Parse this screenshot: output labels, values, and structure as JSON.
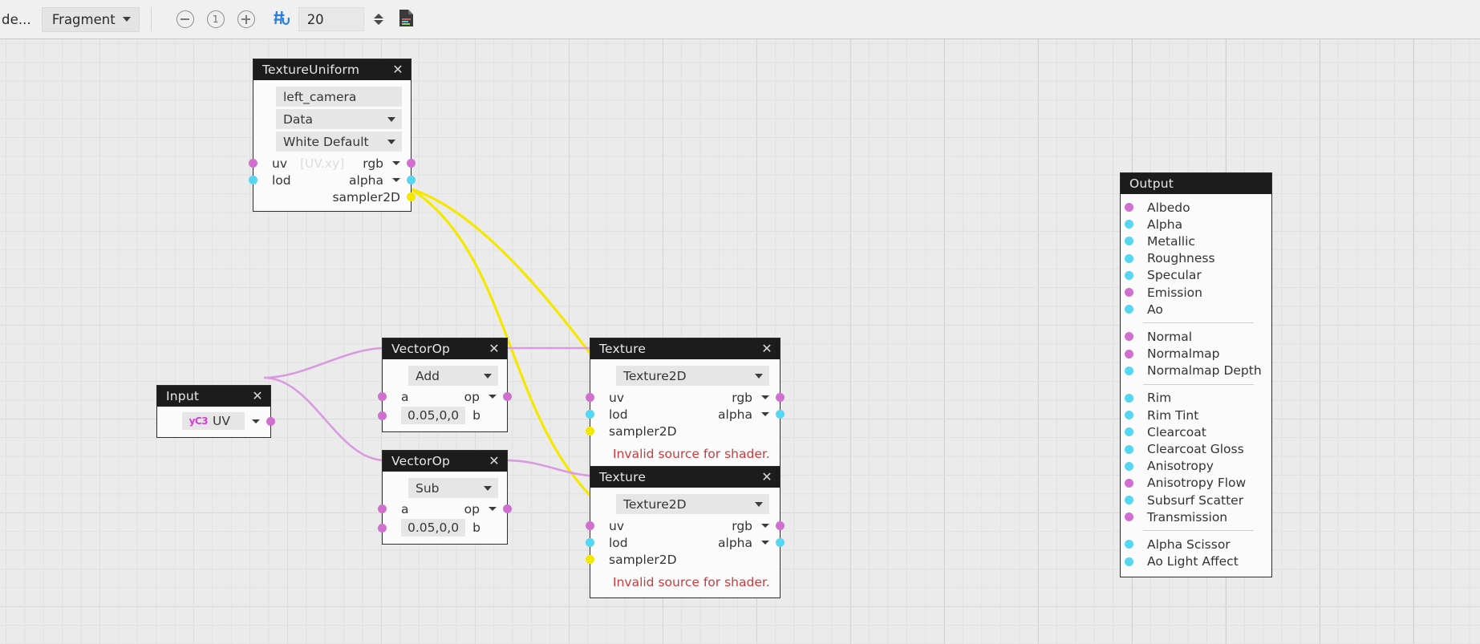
{
  "toolbar": {
    "mode_truncated": "de...",
    "shader_stage": "Fragment",
    "zoom_out_icon": "minus-circle-icon",
    "zoom_reset_label": "1",
    "zoom_in_icon": "plus-circle-icon",
    "snap_icon": "snap-grid-icon",
    "grid_size_value": "20",
    "spinner_icon": "stepper-icon",
    "file_icon": "shader-file-icon",
    "accent_color": "#2b7fe0"
  },
  "nodes": {
    "texture_uniform": {
      "title": "TextureUniform",
      "close": "✕",
      "name_value": "left_camera",
      "scope_value": "Data",
      "default_value": "White Default",
      "ports": [
        {
          "in_label": "uv",
          "ghost": "[UV.xy]",
          "out_label": "rgb",
          "in_color": "#d06fd0",
          "out_color": "#d06fd0"
        },
        {
          "in_label": "lod",
          "ghost": "",
          "out_label": "alpha",
          "in_color": "#55d7f2",
          "out_color": "#55d7f2"
        }
      ],
      "sampler_label": "sampler2D",
      "sampler_color": "#f5e800"
    },
    "input": {
      "title": "Input",
      "close": "✕",
      "glyph": "uv-vector-icon",
      "glyph_text": "уС3",
      "value": "UV",
      "out_color": "#d06fd0"
    },
    "vectorop_add": {
      "title": "VectorOp",
      "close": "✕",
      "operation": "Add",
      "a_label": "a",
      "op_label": "op",
      "b_value": "0.05,0,0",
      "b_label": "b"
    },
    "vectorop_sub": {
      "title": "VectorOp",
      "close": "✕",
      "operation": "Sub",
      "a_label": "a",
      "op_label": "op",
      "b_value": "0.05,0,0",
      "b_label": "b"
    },
    "texture_top": {
      "title": "Texture",
      "close": "✕",
      "type_value": "Texture2D",
      "uv_label": "uv",
      "rgb_label": "rgb",
      "lod_label": "lod",
      "alpha_label": "alpha",
      "sampler_label": "sampler2D",
      "error": "Invalid source for shader."
    },
    "texture_bottom": {
      "title": "Texture",
      "close": "✕",
      "type_value": "Texture2D",
      "uv_label": "uv",
      "rgb_label": "rgb",
      "lod_label": "lod",
      "alpha_label": "alpha",
      "sampler_label": "sampler2D",
      "error": "Invalid source for shader."
    },
    "output": {
      "title": "Output",
      "groups": [
        {
          "rows": [
            {
              "label": "Albedo",
              "color": "#d06fd0"
            },
            {
              "label": "Alpha",
              "color": "#55d7f2"
            },
            {
              "label": "Metallic",
              "color": "#55d7f2"
            },
            {
              "label": "Roughness",
              "color": "#55d7f2"
            },
            {
              "label": "Specular",
              "color": "#55d7f2"
            },
            {
              "label": "Emission",
              "color": "#d06fd0"
            },
            {
              "label": "Ao",
              "color": "#55d7f2"
            }
          ]
        },
        {
          "rows": [
            {
              "label": "Normal",
              "color": "#d06fd0"
            },
            {
              "label": "Normalmap",
              "color": "#d06fd0"
            },
            {
              "label": "Normalmap Depth",
              "color": "#55d7f2"
            }
          ]
        },
        {
          "rows": [
            {
              "label": "Rim",
              "color": "#55d7f2"
            },
            {
              "label": "Rim Tint",
              "color": "#55d7f2"
            },
            {
              "label": "Clearcoat",
              "color": "#55d7f2"
            },
            {
              "label": "Clearcoat Gloss",
              "color": "#55d7f2"
            },
            {
              "label": "Anisotropy",
              "color": "#55d7f2"
            },
            {
              "label": "Anisotropy Flow",
              "color": "#d06fd0"
            },
            {
              "label": "Subsurf Scatter",
              "color": "#55d7f2"
            },
            {
              "label": "Transmission",
              "color": "#d06fd0"
            }
          ]
        },
        {
          "rows": [
            {
              "label": "Alpha Scissor",
              "color": "#55d7f2"
            },
            {
              "label": "Ao Light Affect",
              "color": "#55d7f2"
            }
          ]
        }
      ]
    }
  },
  "wires": {
    "sampler_color": "#f5e800",
    "vector_color": "#d99ae0"
  }
}
